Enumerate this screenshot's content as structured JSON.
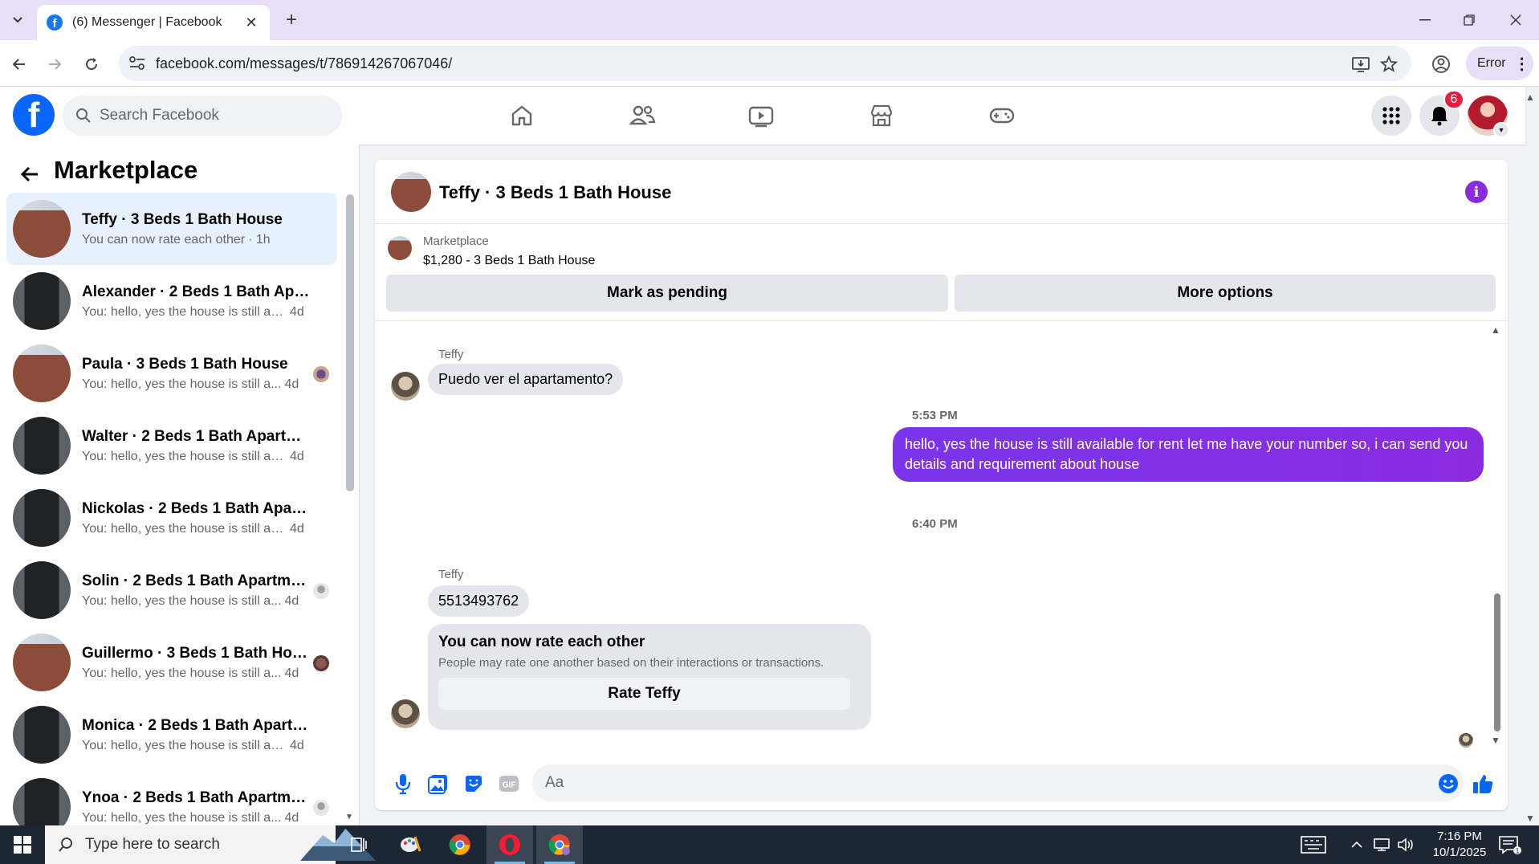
{
  "browser": {
    "tab_title": "(6) Messenger | Facebook",
    "url": "facebook.com/messages/t/786914267067046/",
    "profile_status": "Error",
    "new_tab_glyph": "+",
    "close_glyph": "✕"
  },
  "fb_header": {
    "search_placeholder": "Search Facebook",
    "notification_count": "6",
    "nav_icons": [
      "home-icon",
      "friends-icon",
      "video-icon",
      "marketplace-icon",
      "gaming-icon"
    ]
  },
  "sidebar": {
    "title": "Marketplace",
    "conversations": [
      {
        "name": "Teffy · 3 Beds 1 Bath House",
        "preview": "You can now rate each other",
        "time": "· 1h",
        "avatar": "brick",
        "active": true
      },
      {
        "name": "Alexander · 2 Beds 1 Bath Apart...",
        "preview": "You: hello, yes the house is still avai...",
        "time": "4d",
        "avatar": "door"
      },
      {
        "name": "Paula · 3 Beds 1 Bath House",
        "preview": "You: hello, yes the house is still a...",
        "time": "4d",
        "avatar": "brick"
      },
      {
        "name": "Walter · 2 Beds 1 Bath Apartmen...",
        "preview": "You: hello, yes the house is still avai...",
        "time": "4d",
        "avatar": "door"
      },
      {
        "name": "Nickolas · 2 Beds 1 Bath Apartm...",
        "preview": "You: hello, yes the house is still avai...",
        "time": "4d",
        "avatar": "door"
      },
      {
        "name": "Solin · 2 Beds 1 Bath Apartme...",
        "preview": "You: hello, yes the house is still a...",
        "time": "4d",
        "avatar": "door"
      },
      {
        "name": "Guillermo · 3 Beds 1 Bath House",
        "preview": "You: hello, yes the house is still a...",
        "time": "4d",
        "avatar": "brick"
      },
      {
        "name": "Monica · 2 Beds 1 Bath Apartme...",
        "preview": "You: hello, yes the house is still avai...",
        "time": "4d",
        "avatar": "door"
      },
      {
        "name": "Ynoa · 2 Beds 1 Bath Apartme...",
        "preview": "You: hello, yes the house is still a...",
        "time": "4d",
        "avatar": "door"
      }
    ]
  },
  "chat": {
    "title": "Teffy · 3 Beds 1 Bath House",
    "listing_label": "Marketplace",
    "listing_price": "$1,280 - 3 Beds 1 Bath House",
    "mark_pending": "Mark as pending",
    "more_options": "More options",
    "messages": {
      "sender_1": "Teffy",
      "msg_1": "Puedo ver el apartamento?",
      "time_1": "5:53 PM",
      "out_1": "hello, yes the house is still available for rent  let me have your number so, i can send you details and requirement about house",
      "time_2": "6:40 PM",
      "sender_2": "Teffy",
      "msg_2": "5513493762",
      "rate_title": "You can now rate each other",
      "rate_sub": "People may rate one another based on their interactions or transactions.",
      "rate_btn": "Rate Teffy"
    },
    "composer_placeholder": "Aa"
  },
  "taskbar": {
    "search_placeholder": "Type here to search",
    "time": "7:16 PM",
    "date": "10/1/2025",
    "notif_count": "1"
  },
  "colors": {
    "fb_blue": "#0866ff",
    "accent_purple": "#8a2be2",
    "notif_red": "#e41e3f",
    "active_row": "#e7f0fd"
  }
}
